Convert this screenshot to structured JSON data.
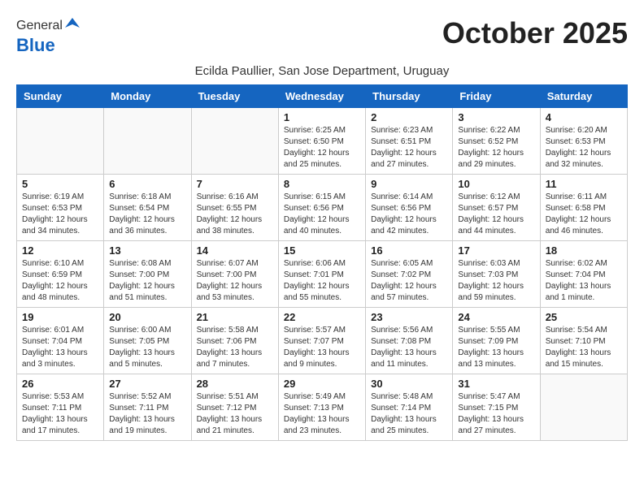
{
  "header": {
    "logo_general": "General",
    "logo_blue": "Blue",
    "month_title": "October 2025",
    "subtitle": "Ecilda Paullier, San Jose Department, Uruguay"
  },
  "weekdays": [
    "Sunday",
    "Monday",
    "Tuesday",
    "Wednesday",
    "Thursday",
    "Friday",
    "Saturday"
  ],
  "weeks": [
    [
      {
        "day": "",
        "info": ""
      },
      {
        "day": "",
        "info": ""
      },
      {
        "day": "",
        "info": ""
      },
      {
        "day": "1",
        "info": "Sunrise: 6:25 AM\nSunset: 6:50 PM\nDaylight: 12 hours\nand 25 minutes."
      },
      {
        "day": "2",
        "info": "Sunrise: 6:23 AM\nSunset: 6:51 PM\nDaylight: 12 hours\nand 27 minutes."
      },
      {
        "day": "3",
        "info": "Sunrise: 6:22 AM\nSunset: 6:52 PM\nDaylight: 12 hours\nand 29 minutes."
      },
      {
        "day": "4",
        "info": "Sunrise: 6:20 AM\nSunset: 6:53 PM\nDaylight: 12 hours\nand 32 minutes."
      }
    ],
    [
      {
        "day": "5",
        "info": "Sunrise: 6:19 AM\nSunset: 6:53 PM\nDaylight: 12 hours\nand 34 minutes."
      },
      {
        "day": "6",
        "info": "Sunrise: 6:18 AM\nSunset: 6:54 PM\nDaylight: 12 hours\nand 36 minutes."
      },
      {
        "day": "7",
        "info": "Sunrise: 6:16 AM\nSunset: 6:55 PM\nDaylight: 12 hours\nand 38 minutes."
      },
      {
        "day": "8",
        "info": "Sunrise: 6:15 AM\nSunset: 6:56 PM\nDaylight: 12 hours\nand 40 minutes."
      },
      {
        "day": "9",
        "info": "Sunrise: 6:14 AM\nSunset: 6:56 PM\nDaylight: 12 hours\nand 42 minutes."
      },
      {
        "day": "10",
        "info": "Sunrise: 6:12 AM\nSunset: 6:57 PM\nDaylight: 12 hours\nand 44 minutes."
      },
      {
        "day": "11",
        "info": "Sunrise: 6:11 AM\nSunset: 6:58 PM\nDaylight: 12 hours\nand 46 minutes."
      }
    ],
    [
      {
        "day": "12",
        "info": "Sunrise: 6:10 AM\nSunset: 6:59 PM\nDaylight: 12 hours\nand 48 minutes."
      },
      {
        "day": "13",
        "info": "Sunrise: 6:08 AM\nSunset: 7:00 PM\nDaylight: 12 hours\nand 51 minutes."
      },
      {
        "day": "14",
        "info": "Sunrise: 6:07 AM\nSunset: 7:00 PM\nDaylight: 12 hours\nand 53 minutes."
      },
      {
        "day": "15",
        "info": "Sunrise: 6:06 AM\nSunset: 7:01 PM\nDaylight: 12 hours\nand 55 minutes."
      },
      {
        "day": "16",
        "info": "Sunrise: 6:05 AM\nSunset: 7:02 PM\nDaylight: 12 hours\nand 57 minutes."
      },
      {
        "day": "17",
        "info": "Sunrise: 6:03 AM\nSunset: 7:03 PM\nDaylight: 12 hours\nand 59 minutes."
      },
      {
        "day": "18",
        "info": "Sunrise: 6:02 AM\nSunset: 7:04 PM\nDaylight: 13 hours\nand 1 minute."
      }
    ],
    [
      {
        "day": "19",
        "info": "Sunrise: 6:01 AM\nSunset: 7:04 PM\nDaylight: 13 hours\nand 3 minutes."
      },
      {
        "day": "20",
        "info": "Sunrise: 6:00 AM\nSunset: 7:05 PM\nDaylight: 13 hours\nand 5 minutes."
      },
      {
        "day": "21",
        "info": "Sunrise: 5:58 AM\nSunset: 7:06 PM\nDaylight: 13 hours\nand 7 minutes."
      },
      {
        "day": "22",
        "info": "Sunrise: 5:57 AM\nSunset: 7:07 PM\nDaylight: 13 hours\nand 9 minutes."
      },
      {
        "day": "23",
        "info": "Sunrise: 5:56 AM\nSunset: 7:08 PM\nDaylight: 13 hours\nand 11 minutes."
      },
      {
        "day": "24",
        "info": "Sunrise: 5:55 AM\nSunset: 7:09 PM\nDaylight: 13 hours\nand 13 minutes."
      },
      {
        "day": "25",
        "info": "Sunrise: 5:54 AM\nSunset: 7:10 PM\nDaylight: 13 hours\nand 15 minutes."
      }
    ],
    [
      {
        "day": "26",
        "info": "Sunrise: 5:53 AM\nSunset: 7:11 PM\nDaylight: 13 hours\nand 17 minutes."
      },
      {
        "day": "27",
        "info": "Sunrise: 5:52 AM\nSunset: 7:11 PM\nDaylight: 13 hours\nand 19 minutes."
      },
      {
        "day": "28",
        "info": "Sunrise: 5:51 AM\nSunset: 7:12 PM\nDaylight: 13 hours\nand 21 minutes."
      },
      {
        "day": "29",
        "info": "Sunrise: 5:49 AM\nSunset: 7:13 PM\nDaylight: 13 hours\nand 23 minutes."
      },
      {
        "day": "30",
        "info": "Sunrise: 5:48 AM\nSunset: 7:14 PM\nDaylight: 13 hours\nand 25 minutes."
      },
      {
        "day": "31",
        "info": "Sunrise: 5:47 AM\nSunset: 7:15 PM\nDaylight: 13 hours\nand 27 minutes."
      },
      {
        "day": "",
        "info": ""
      }
    ]
  ]
}
